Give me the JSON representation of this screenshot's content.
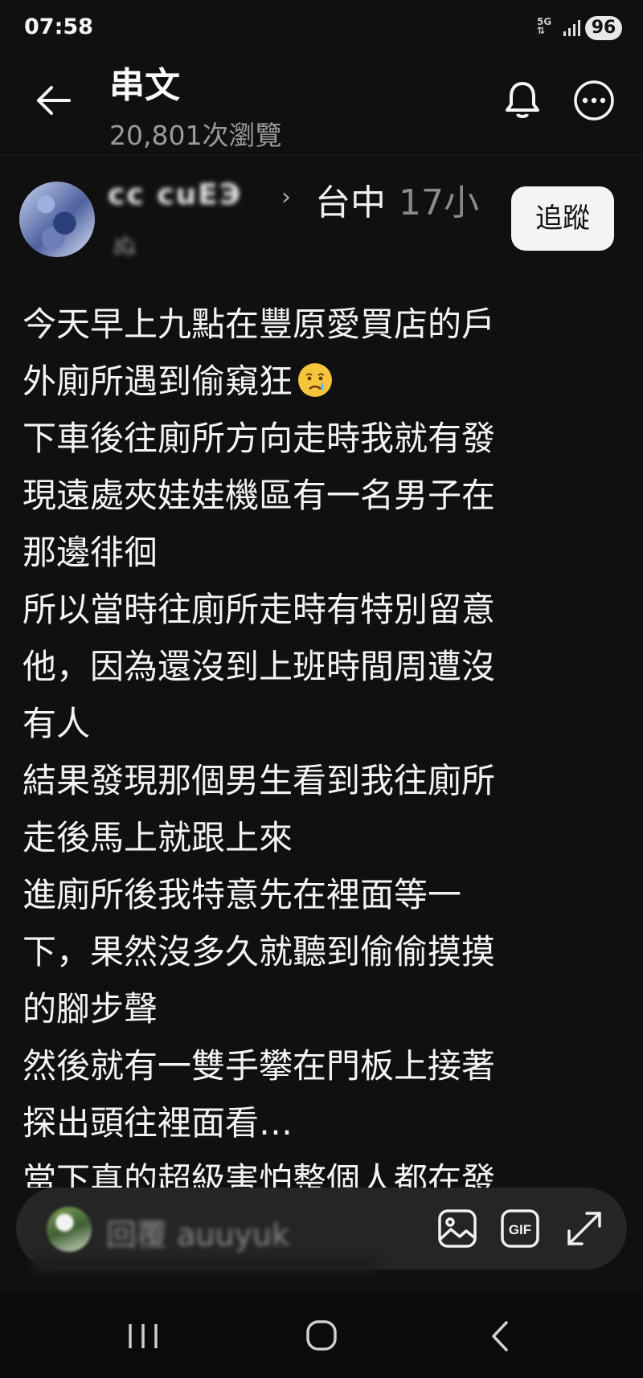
{
  "status_bar": {
    "time": "07:58",
    "network": "5G",
    "battery": "96"
  },
  "header": {
    "title": "串文",
    "views": "20,801次瀏覽"
  },
  "post": {
    "author_name": "cc  cuЕЭ",
    "author_sub": "ぬ",
    "location": "台中",
    "age": "17小",
    "follow_label": "追蹤",
    "lines": [
      "今天早上九點在豐原愛買店的戶",
      "外廁所遇到偷窺狂",
      "下車後往廁所方向走時我就有發",
      "現遠處夾娃娃機區有一名男子在",
      "那邊徘徊",
      "所以當時往廁所走時有特別留意",
      "他，因為還沒到上班時間周遭沒",
      "有人",
      "結果發現那個男生看到我往廁所",
      "走後馬上就跟上來",
      "進廁所後我特意先在裡面等一",
      "下，果然沒多久就聽到偷偷摸摸",
      "的腳步聲",
      "然後就有一雙手攀在門板上接著",
      "探出頭往裡面看…",
      "當下真的超級害怕整個人都在發"
    ]
  },
  "composer": {
    "placeholder": "回覆 auuyuk"
  },
  "icons": {
    "back": "arrow-left-icon",
    "notify": "bell-icon",
    "more": "more-horizontal-icon",
    "image": "image-icon",
    "gif": "gif-icon",
    "expand": "expand-icon",
    "emoji": "crying-face-emoji"
  },
  "colors": {
    "background": "#101010",
    "text": "#f4f4f4",
    "muted": "#9a9a9a",
    "follow_bg": "#f4f4f4"
  }
}
